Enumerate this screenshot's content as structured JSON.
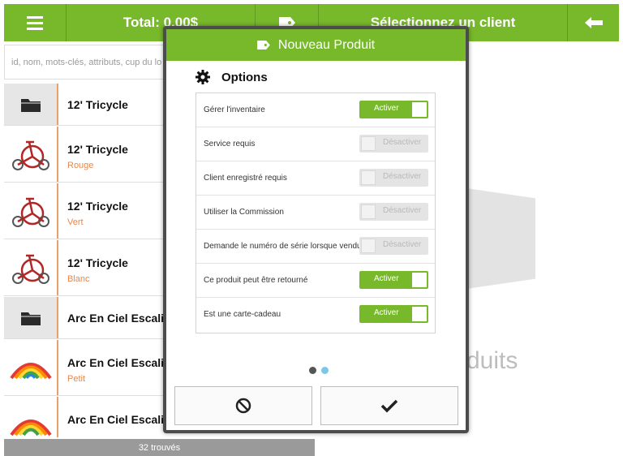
{
  "topbar": {
    "total_label": "Total: 0.00$",
    "client_label": "Sélectionnez un client"
  },
  "search": {
    "placeholder": "id, nom, mots-clés, attributs, cup du lo"
  },
  "list": {
    "items": [
      {
        "type": "folder",
        "name": "12' Tricycle",
        "subtitle": ""
      },
      {
        "type": "item",
        "name": "12' Tricycle",
        "subtitle": "Rouge",
        "image": "tricycle-icon"
      },
      {
        "type": "item",
        "name": "12' Tricycle",
        "subtitle": "Vert",
        "image": "tricycle-icon"
      },
      {
        "type": "item",
        "name": "12' Tricycle",
        "subtitle": "Blanc",
        "image": "tricycle-icon"
      },
      {
        "type": "folder",
        "name": "Arc En Ciel Escalier R",
        "subtitle": ""
      },
      {
        "type": "item",
        "name": "Arc En Ciel Escalier",
        "subtitle": "Petit",
        "image": "rainbow-spring-icon"
      },
      {
        "type": "item",
        "name": "Arc En Ciel Escalier",
        "subtitle": "",
        "image": "rainbow-spring-icon"
      }
    ],
    "count_label": "32 trouvés"
  },
  "background": {
    "partial_text": "duits"
  },
  "modal": {
    "title": "Nouveau Produit",
    "section_title": "Options",
    "options": [
      {
        "label": "Gérer l'inventaire",
        "state": "on",
        "toggle_label": "Activer"
      },
      {
        "label": "Service requis",
        "state": "off",
        "toggle_label": "Désactiver"
      },
      {
        "label": "Client enregistré requis",
        "state": "off",
        "toggle_label": "Désactiver"
      },
      {
        "label": "Utiliser la Commission",
        "state": "off",
        "toggle_label": "Désactiver"
      },
      {
        "label": "Demande le numéro de série lorsque vendu",
        "state": "off",
        "toggle_label": "Désactiver"
      },
      {
        "label": "Ce produit peut être retourné",
        "state": "on",
        "toggle_label": "Activer"
      },
      {
        "label": "Est une carte-cadeau",
        "state": "on",
        "toggle_label": "Activer"
      }
    ],
    "page_dots": {
      "count": 2,
      "active_index": 1
    },
    "cancel_icon": "cancel-icon",
    "confirm_icon": "checkmark-icon"
  },
  "colors": {
    "brand_green": "#78b92b",
    "accent_orange": "#e8884a",
    "dot_inactive": "#555555",
    "dot_active": "#7ec6e8"
  }
}
